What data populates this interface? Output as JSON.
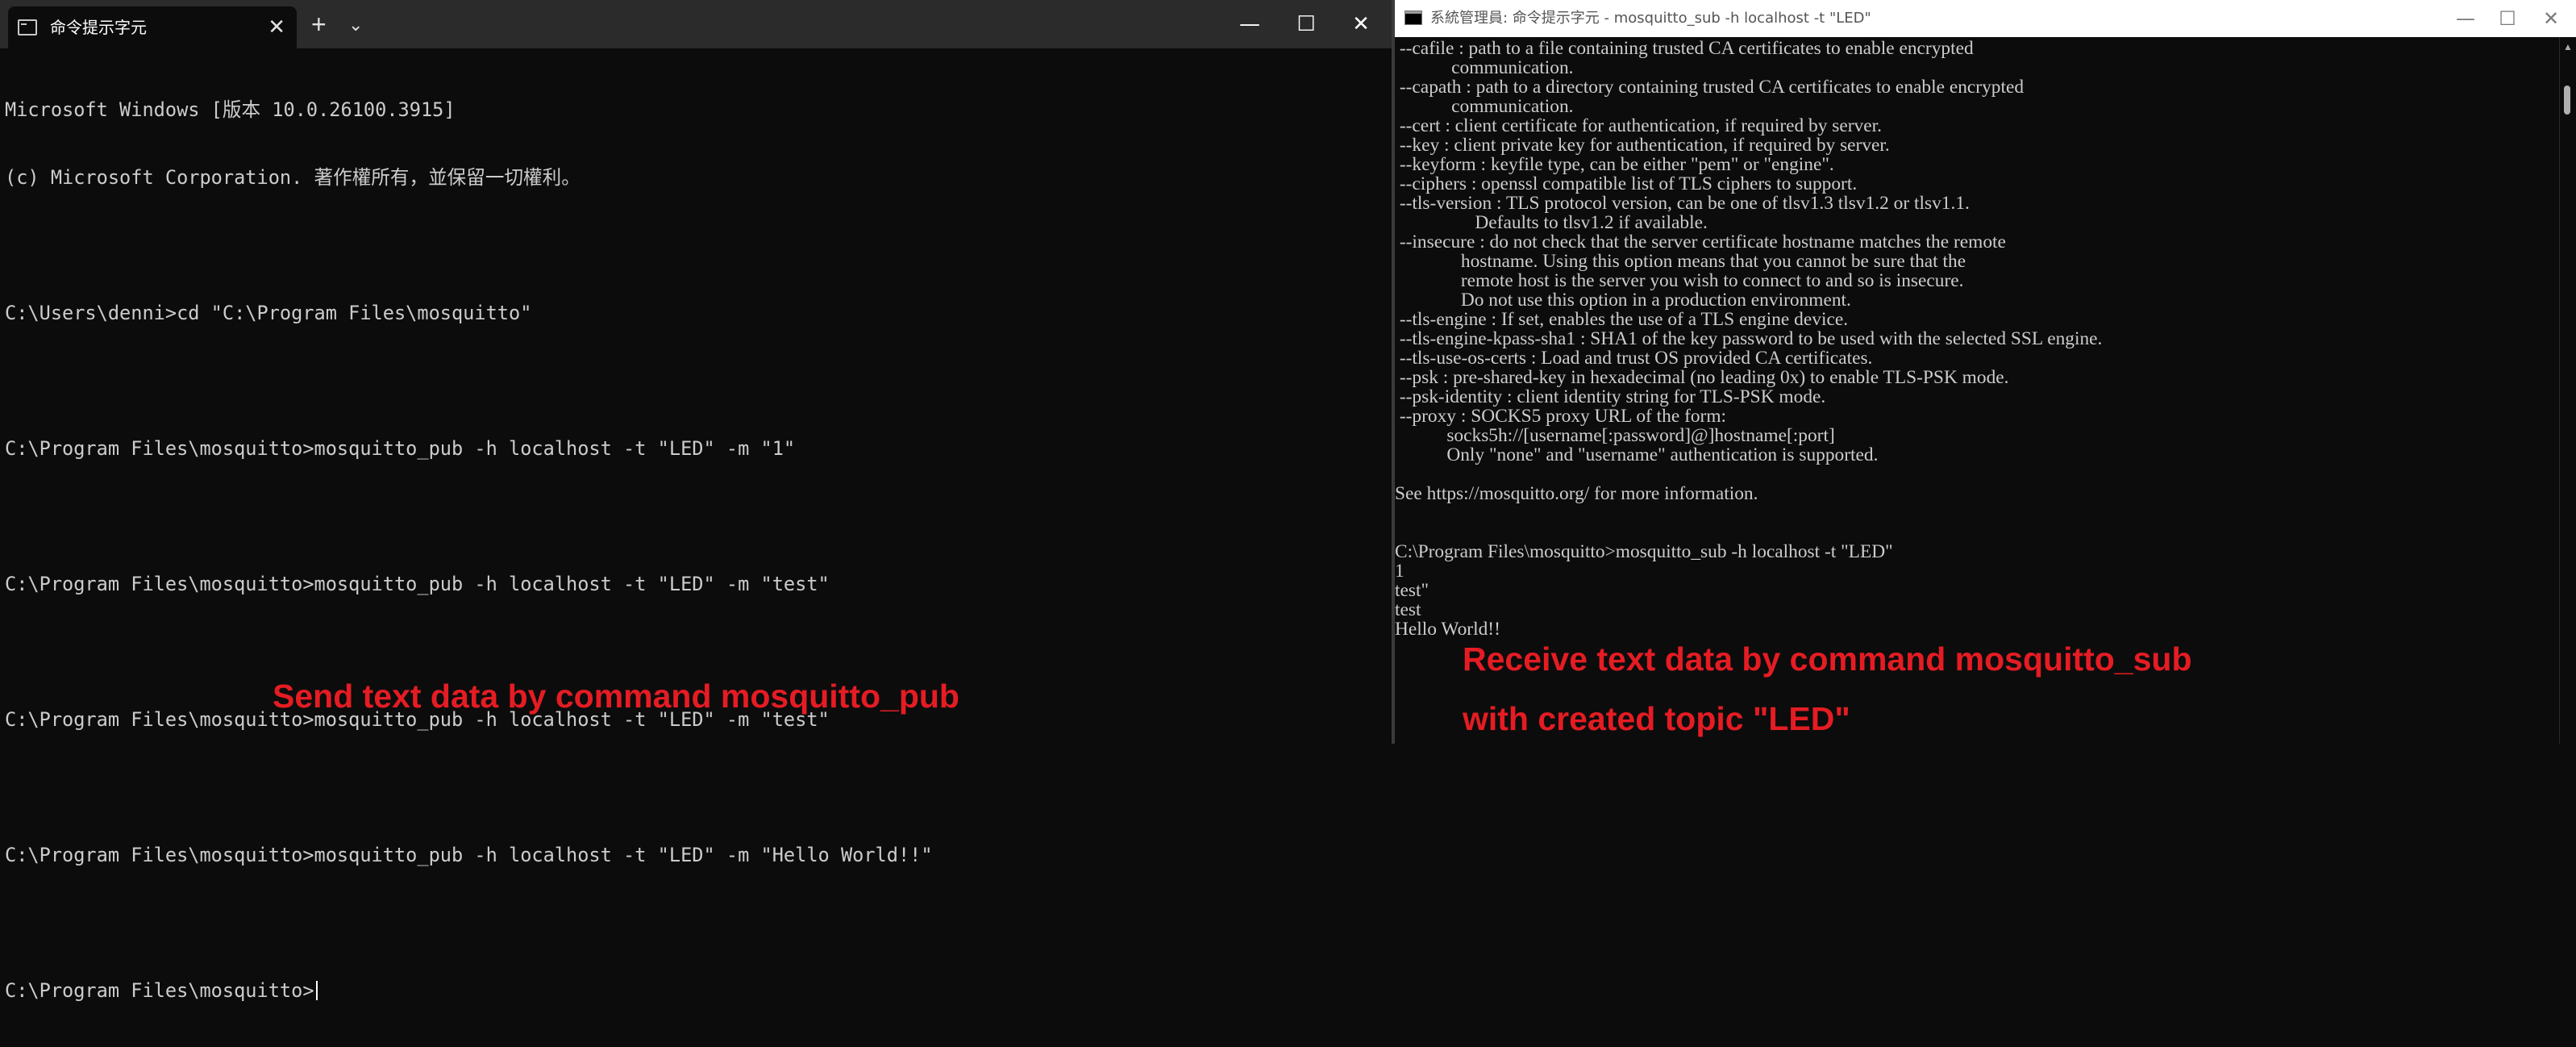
{
  "left_window": {
    "tab_title": "命令提示字元",
    "tab_close": "✕",
    "new_tab": "+",
    "tab_dropdown": "⌄",
    "minimize": "—",
    "maximize": "☐",
    "close": "✕",
    "lines": [
      "Microsoft Windows [版本 10.0.26100.3915]",
      "(c) Microsoft Corporation. 著作權所有，並保留一切權利。",
      "",
      "C:\\Users\\denni>cd \"C:\\Program Files\\mosquitto\"",
      "",
      "C:\\Program Files\\mosquitto>mosquitto_pub -h localhost -t \"LED\" -m \"1\"",
      "",
      "C:\\Program Files\\mosquitto>mosquitto_pub -h localhost -t \"LED\" -m \"test\"",
      "",
      "C:\\Program Files\\mosquitto>mosquitto_pub -h localhost -t \"LED\" -m \"test\"",
      "",
      "C:\\Program Files\\mosquitto>mosquitto_pub -h localhost -t \"LED\" -m \"Hello World!!\"",
      ""
    ],
    "prompt_line": "C:\\Program Files\\mosquitto>",
    "caption": "Send text data by command mosquitto_pub"
  },
  "right_window": {
    "title": "系統管理員: 命令提示字元 - mosquitto_sub  -h localhost -t \"LED\"",
    "minimize": "—",
    "maximize": "☐",
    "close": "✕",
    "lines": [
      " --cafile : path to a file containing trusted CA certificates to enable encrypted",
      "            communication.",
      " --capath : path to a directory containing trusted CA certificates to enable encrypted",
      "            communication.",
      " --cert : client certificate for authentication, if required by server.",
      " --key : client private key for authentication, if required by server.",
      " --keyform : keyfile type, can be either \"pem\" or \"engine\".",
      " --ciphers : openssl compatible list of TLS ciphers to support.",
      " --tls-version : TLS protocol version, can be one of tlsv1.3 tlsv1.2 or tlsv1.1.",
      "                 Defaults to tlsv1.2 if available.",
      " --insecure : do not check that the server certificate hostname matches the remote",
      "              hostname. Using this option means that you cannot be sure that the",
      "              remote host is the server you wish to connect to and so is insecure.",
      "              Do not use this option in a production environment.",
      " --tls-engine : If set, enables the use of a TLS engine device.",
      " --tls-engine-kpass-sha1 : SHA1 of the key password to be used with the selected SSL engine.",
      " --tls-use-os-certs : Load and trust OS provided CA certificates.",
      " --psk : pre-shared-key in hexadecimal (no leading 0x) to enable TLS-PSK mode.",
      " --psk-identity : client identity string for TLS-PSK mode.",
      " --proxy : SOCKS5 proxy URL of the form:",
      "           socks5h://[username[:password]@]hostname[:port]",
      "           Only \"none\" and \"username\" authentication is supported.",
      "",
      "See https://mosquitto.org/ for more information.",
      "",
      "",
      "C:\\Program Files\\mosquitto>mosquitto_sub -h localhost -t \"LED\"",
      "1",
      "test\"",
      "test",
      "Hello World!!"
    ],
    "caption_line1": "Receive text data by command mosquitto_sub",
    "caption_line2": "with created topic \"LED\""
  },
  "colors": {
    "console_bg": "#0c0c0c",
    "console_text": "#cccccc",
    "caption_red": "#e51c23",
    "terminal_titlebar": "#2b2b2b",
    "classic_titlebar": "#ffffff"
  },
  "icons": {
    "tab_icon": "terminal-icon",
    "window_icon": "cmd-icon"
  }
}
